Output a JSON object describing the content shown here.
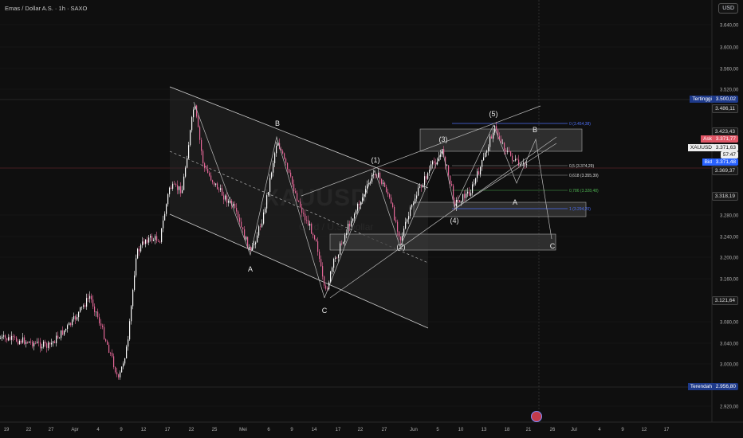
{
  "header": {
    "symbol_title": "Emas / Dollar A.S. · 1h · SAXO",
    "currency": "USD",
    "watermark_symbol": "XAUUSD",
    "watermark_name": "Gold / U.S. Dollar"
  },
  "colors": {
    "background": "#0f0f0f",
    "candle_up": "#f9f9f9",
    "candle_down": "#e36797",
    "grid": "#1b1b1b",
    "channel_fill": "#2a2a2a",
    "zone_fill": "#3a3a3a",
    "fib_blue": "#4c6ef5",
    "fib_green": "#4caf50",
    "ask_red": "#e05666",
    "bid_blue": "#2962ff",
    "high_label": "#1e3a8a"
  },
  "axis": {
    "price_labels": [
      "3.640,00",
      "3.600,00",
      "3.560,00",
      "3.520,00",
      "3.280,00",
      "3.240,00",
      "3.200,00",
      "3.160,00",
      "3.080,00",
      "3.040,00",
      "3.000,00",
      "2.920,00"
    ],
    "date_labels": [
      "19",
      "22",
      "27",
      "Apr",
      "4",
      "9",
      "12",
      "17",
      "22",
      "25",
      "Mei",
      "6",
      "9",
      "14",
      "17",
      "22",
      "27",
      "Jun",
      "5",
      "10",
      "13",
      "18",
      "21",
      "26",
      "Jul",
      "4",
      "9",
      "12",
      "17"
    ]
  },
  "price_flags": {
    "high_label": "Tertinggi",
    "high_value": "3.500,02",
    "p1": "3.486,11",
    "p2": "3.423,43",
    "ask_label": "Ask",
    "ask_value": "3.371,77",
    "symbol_tag": "XAUUSD",
    "last_value": "3.371,63",
    "countdown": "57:47",
    "bid_label": "Bid",
    "bid_value": "3.371,48",
    "p3": "3.369,37",
    "p4": "3.318,19",
    "p5": "3.121,64",
    "low_label": "Terendah",
    "low_value": "2.956,80"
  },
  "fib_labels": {
    "f0": "0 (3.454,38)",
    "f05": "0,5 (3.374,29)",
    "f0618": "0,618 (3.355,39)",
    "f0786": "0,786 (3.328,48)",
    "f1": "1 (3.294,20)"
  },
  "wave_labels": {
    "A1": "A",
    "B1": "B",
    "C1": "C",
    "w1": "(1)",
    "w2": "(2)",
    "w3": "(3)",
    "w4": "(4)",
    "w5": "(5)",
    "A2": "A",
    "B2": "B",
    "C2": "C"
  }
}
